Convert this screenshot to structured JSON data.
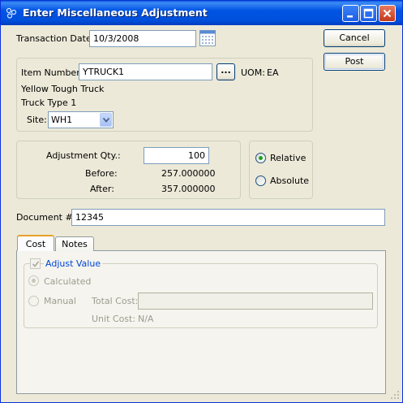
{
  "window": {
    "title": "Enter Miscellaneous Adjustment",
    "app_icon": "app-dots-icon",
    "controls": [
      "minimize-icon",
      "maximize-icon",
      "close-icon"
    ]
  },
  "header": {
    "transaction_date_label": "Transaction Date:",
    "transaction_date_value": "10/3/2008",
    "calendar_icon": "calendar-icon"
  },
  "actions": {
    "cancel_label": "Cancel",
    "post_label": "Post"
  },
  "item": {
    "item_number_label": "Item Number:",
    "item_number_value": "YTRUCK1",
    "lookup_label": "...",
    "uom_label": "UOM:",
    "uom_value": "EA",
    "description1": "Yellow Tough Truck",
    "description2": "Truck Type 1",
    "site_label": "Site:",
    "site_value": "WH1"
  },
  "adjustment": {
    "qty_label": "Adjustment Qty.:",
    "qty_value": "100",
    "before_label": "Before:",
    "before_value": "257.000000",
    "after_label": "After:",
    "after_value": "357.000000",
    "mode_options": [
      "Relative",
      "Absolute"
    ],
    "mode_selected": "Relative"
  },
  "document": {
    "label": "Document #:",
    "value": "12345"
  },
  "tabs": {
    "items": [
      "Cost",
      "Notes"
    ],
    "active": "Cost"
  },
  "cost": {
    "adjust_value_label": "Adjust Value",
    "adjust_value_checked": true,
    "calculated_label": "Calculated",
    "manual_label": "Manual",
    "selected": "Calculated",
    "total_cost_label": "Total Cost:",
    "total_cost_value": "",
    "unit_cost_label": "Unit Cost:",
    "unit_cost_value": "N/A"
  },
  "colors": {
    "titlebar": "#0054e3",
    "window_bg": "#ece9d8",
    "group_title_blue": "#0046d5",
    "disabled_text": "#9e9b8f"
  }
}
